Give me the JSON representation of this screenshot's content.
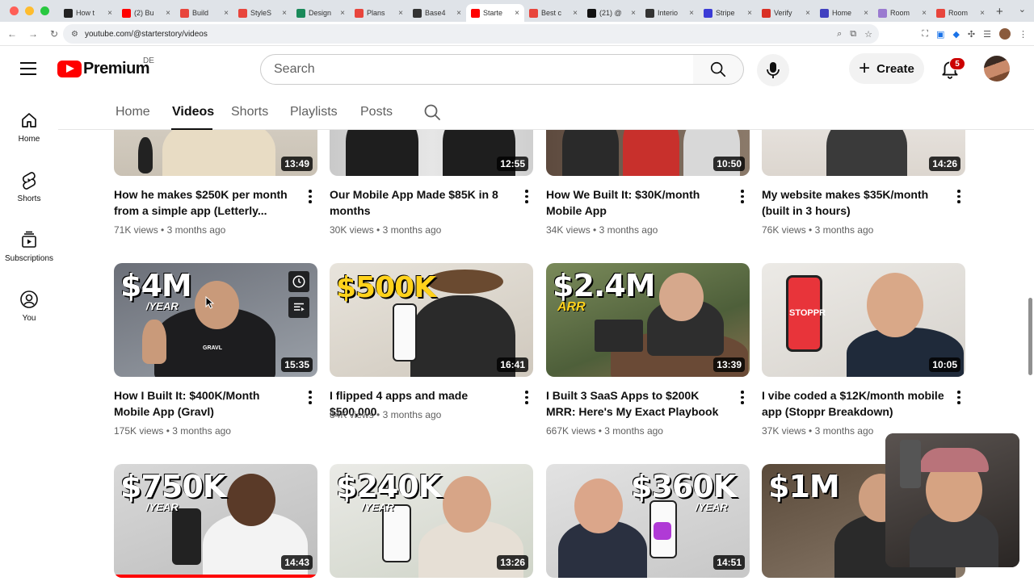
{
  "browser": {
    "tabs": [
      {
        "label": "How t",
        "color": "#222222"
      },
      {
        "label": "(2) Bu",
        "color": "#ff0000"
      },
      {
        "label": "Build",
        "color": "#e8453c"
      },
      {
        "label": "StyleS",
        "color": "#e8453c"
      },
      {
        "label": "Design",
        "color": "#1a8a5a"
      },
      {
        "label": "Plans",
        "color": "#e8453c"
      },
      {
        "label": "Base4",
        "color": "#333333"
      },
      {
        "label": "Starte",
        "color": "#ff0000"
      },
      {
        "label": "Best c",
        "color": "#e8453c"
      },
      {
        "label": "(21) @",
        "color": "#111111"
      },
      {
        "label": "Interio",
        "color": "#333333"
      },
      {
        "label": "Stripe",
        "color": "#3b3bd6"
      },
      {
        "label": "Verify",
        "color": "#d93025"
      },
      {
        "label": "Home",
        "color": "#4040c0"
      },
      {
        "label": "Room",
        "color": "#9a7ad0"
      },
      {
        "label": "Room",
        "color": "#e8453c"
      }
    ],
    "active_tab_index": 7,
    "url": "youtube.com/@starterstory/videos"
  },
  "masthead": {
    "logo_word": "Premium",
    "region": "DE",
    "search_placeholder": "Search",
    "create_label": "Create",
    "notification_count": "5"
  },
  "guide": [
    {
      "label": "Home",
      "icon": "home-icon"
    },
    {
      "label": "Shorts",
      "icon": "shorts-icon"
    },
    {
      "label": "Subscriptions",
      "icon": "subscriptions-icon"
    },
    {
      "label": "You",
      "icon": "you-icon"
    }
  ],
  "channel_tabs": [
    "Home",
    "Videos",
    "Shorts",
    "Playlists",
    "Posts"
  ],
  "active_channel_tab": "Videos",
  "videos_row1": [
    {
      "title": "How he makes $250K per month from a simple app (Letterly...",
      "views": "71K views",
      "age": "3 months ago",
      "duration": "13:49"
    },
    {
      "title": "Our Mobile App Made $85K in 8 months",
      "views": "30K views",
      "age": "3 months ago",
      "duration": "12:55"
    },
    {
      "title": "How We Built It: $30K/month Mobile App",
      "views": "34K views",
      "age": "3 months ago",
      "duration": "10:50"
    },
    {
      "title": "My website makes $35K/month (built in 3 hours)",
      "views": "76K views",
      "age": "3 months ago",
      "duration": "14:26"
    }
  ],
  "videos_row2": [
    {
      "title": "How I Built It: $400K/Month Mobile App (Gravl)",
      "views": "175K views",
      "age": "3 months ago",
      "duration": "15:35",
      "thumb_text": "$4M",
      "thumb_sub": "/YEAR",
      "shirt_text": "GRAVL"
    },
    {
      "title": "I flipped 4 apps and made $500,000",
      "views": "84K views",
      "age": "3 months ago",
      "duration": "16:41",
      "thumb_text": "$500K"
    },
    {
      "title": "I Built 3 SaaS Apps to $200K MRR: Here's My Exact Playbook",
      "views": "667K views",
      "age": "3 months ago",
      "duration": "13:39",
      "thumb_text": "$2.4M",
      "thumb_sub": "ARR"
    },
    {
      "title": "I vibe coded a $12K/month mobile app (Stoppr Breakdown)",
      "views": "37K views",
      "age": "3 months ago",
      "duration": "10:05",
      "phone_text": "STOPPR"
    }
  ],
  "videos_row3": [
    {
      "duration": "14:43",
      "thumb_text": "$750K",
      "thumb_sub": "/YEAR",
      "watched_progress_pct": 100
    },
    {
      "duration": "13:26",
      "thumb_text": "$240K",
      "thumb_sub": "/YEAR"
    },
    {
      "duration": "14:51",
      "thumb_text": "$360K",
      "thumb_sub": "/YEAR"
    },
    {
      "duration": "",
      "thumb_text": "$1M"
    }
  ]
}
